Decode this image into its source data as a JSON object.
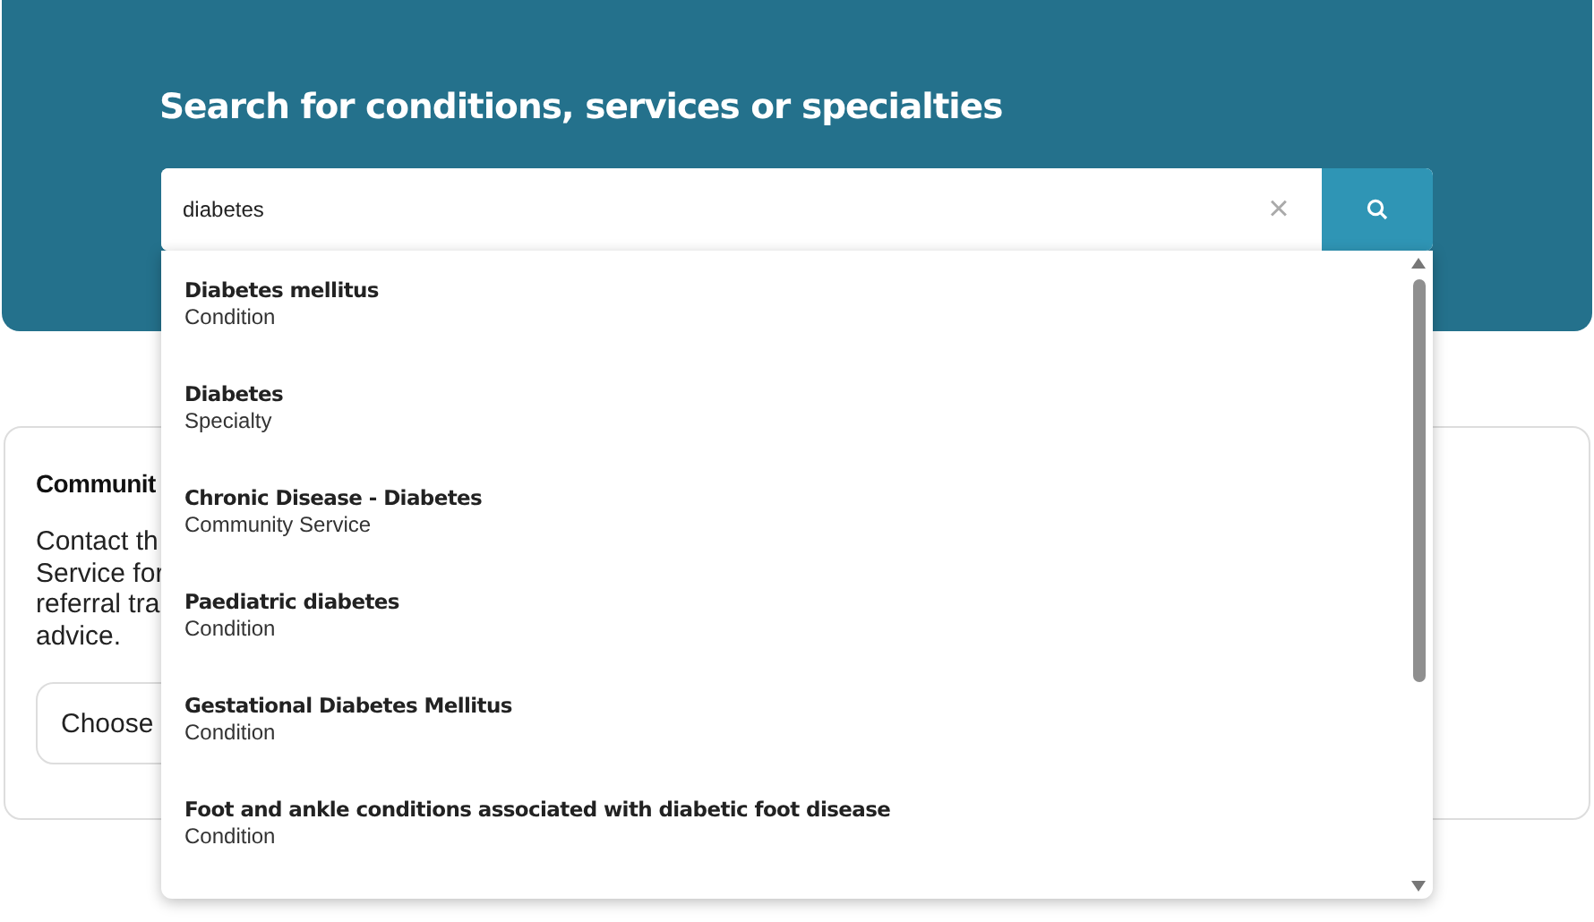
{
  "hero": {
    "title": "Search for conditions, services or specialties"
  },
  "search": {
    "value": "diabetes",
    "clear_icon": "×"
  },
  "suggestions": [
    {
      "title": "Diabetes mellitus",
      "type": "Condition"
    },
    {
      "title": "Diabetes",
      "type": "Specialty"
    },
    {
      "title": "Chronic Disease - Diabetes",
      "type": "Community Service"
    },
    {
      "title": "Paediatric diabetes",
      "type": "Condition"
    },
    {
      "title": "Gestational Diabetes Mellitus",
      "type": "Condition"
    },
    {
      "title": "Foot and ankle conditions associated with diabetic foot disease",
      "type": "Condition"
    }
  ],
  "card": {
    "title": "Communit",
    "text_lines": [
      "Contact th",
      "Service for",
      "referral tra",
      "advice."
    ],
    "button": "Choose"
  }
}
